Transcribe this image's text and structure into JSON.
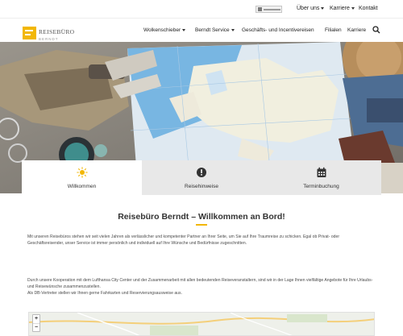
{
  "topbar": {
    "links": [
      {
        "label": "Über uns"
      },
      {
        "label": "Karriere"
      },
      {
        "label": "Kontakt"
      }
    ]
  },
  "brand": {
    "name": "REISEBÜRO",
    "sub": "BERNDT",
    "accent": "#f2b705"
  },
  "nav": {
    "items": [
      {
        "label": "Wolkenschieber"
      },
      {
        "label": "Berndt Service"
      },
      {
        "label": "Geschäfts- und Incentivereisen"
      },
      {
        "label": "Filialen"
      },
      {
        "label": "Karriere"
      }
    ]
  },
  "tabs": [
    {
      "label": "Willkommen",
      "icon": "sun-icon",
      "active": true
    },
    {
      "label": "Reisehinweise",
      "icon": "alert-icon",
      "active": false
    },
    {
      "label": "Terminbuchung",
      "icon": "calendar-icon",
      "active": false
    }
  ],
  "content": {
    "title": "Reisebüro Berndt – Willkommen an Bord!",
    "p1": "Mit unseren Reisebüros stehen wir seit vielen Jahren als verlässlicher und kompetenter Partner an Ihrer Seite, um Sie auf Ihre Traumreise zu schicken. Egal ob Privat- oder Geschäftsreisender, unser Service ist immer persönlich und individuell auf Ihre Wünsche und Bedürfnisse zugeschnitten.",
    "p2": "Durch unsere Kooperation mit dem Lufthansa City Center und der Zusammenarbeit mit allen bedeutenden Reiseveranstaltern, sind wir in der Lage Ihnen vielfältige Angebote für Ihre Urlaubs- und Reisewünsche zusammenzustellen.",
    "p3": "Als DB-Vertreter stellen wir Ihnen gerne Fahrkarten und Reservierungsausweise aus."
  },
  "map": {
    "zoom_in": "+",
    "zoom_out": "−"
  }
}
